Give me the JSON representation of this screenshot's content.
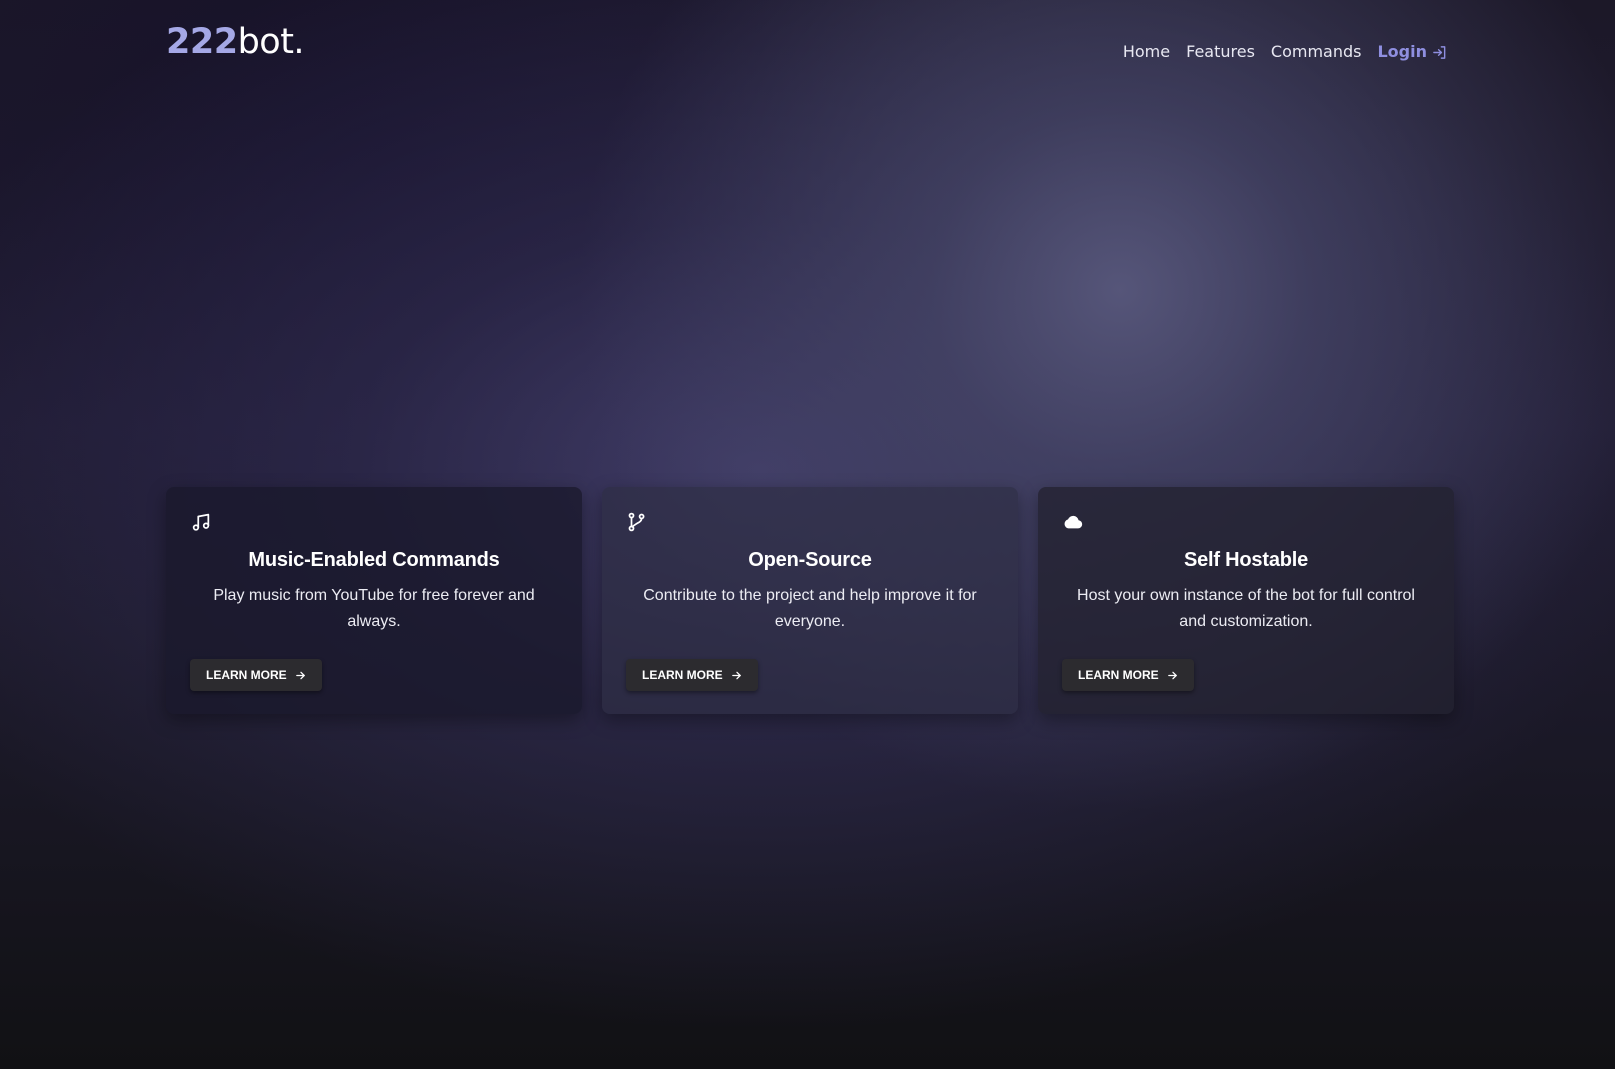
{
  "brand": {
    "logo_number": "222",
    "logo_word": "bot."
  },
  "nav": {
    "items": [
      {
        "label": "Home"
      },
      {
        "label": "Features"
      },
      {
        "label": "Commands"
      }
    ],
    "login_label": "Login",
    "login_icon": "login-arrow-icon"
  },
  "cards": [
    {
      "icon": "music-note-icon",
      "title": "Music-Enabled Commands",
      "text": "Play music from YouTube for free forever and always.",
      "button_label": "LEARN MORE"
    },
    {
      "icon": "git-branch-icon",
      "title": "Open-Source",
      "text": "Contribute to the project and help improve it for everyone.",
      "button_label": "LEARN MORE"
    },
    {
      "icon": "cloud-icon",
      "title": "Self Hostable",
      "text": "Host your own instance of the bot for full control and customization.",
      "button_label": "LEARN MORE"
    }
  ],
  "colors": {
    "accent": "#8f8fe0",
    "logo_accent": "#a5a8e6",
    "button_bg": "#2c2b2f"
  }
}
